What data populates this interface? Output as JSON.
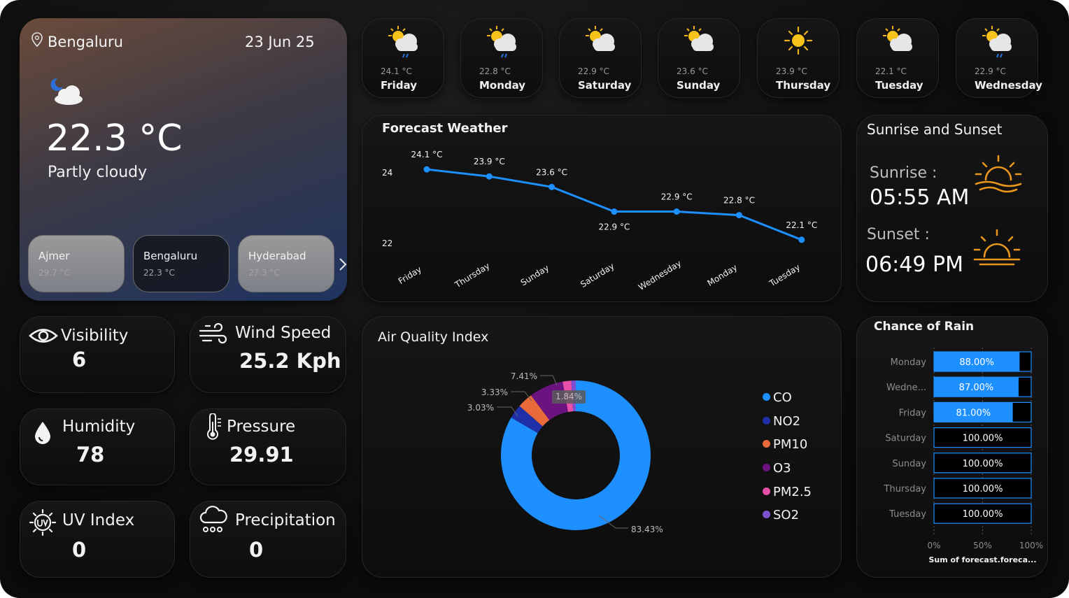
{
  "hero": {
    "city": "Bengaluru",
    "date": "23 Jun 25",
    "temperature": "22.3 °C",
    "condition": "Partly cloudy",
    "cities": [
      {
        "name": "Ajmer",
        "temp": "29.7 °C"
      },
      {
        "name": "Bengaluru",
        "temp": "22.3 °C"
      },
      {
        "name": "Hyderabad",
        "temp": "27.3 °C"
      }
    ],
    "next_icon": "chevron-right-icon"
  },
  "days": [
    {
      "temp": "24.1 °C",
      "day": "Friday",
      "icon": "sun-cloud-rain-icon"
    },
    {
      "temp": "22.8 °C",
      "day": "Monday",
      "icon": "sun-cloud-rain-icon"
    },
    {
      "temp": "22.9 °C",
      "day": "Saturday",
      "icon": "sun-cloud-icon"
    },
    {
      "temp": "23.6 °C",
      "day": "Sunday",
      "icon": "sun-cloud-icon"
    },
    {
      "temp": "23.9 °C",
      "day": "Thursday",
      "icon": "sun-icon"
    },
    {
      "temp": "22.1 °C",
      "day": "Tuesday",
      "icon": "sun-cloud-icon"
    },
    {
      "temp": "22.9 °C",
      "day": "Wednesday",
      "icon": "sun-cloud-rain-icon"
    }
  ],
  "metrics": {
    "visibility": {
      "label": "Visibility",
      "value": "6"
    },
    "wind": {
      "label": "Wind Speed",
      "value": "25.2 Kph"
    },
    "humidity": {
      "label": "Humidity",
      "value": "78"
    },
    "pressure": {
      "label": "Pressure",
      "value": "29.91"
    },
    "uv": {
      "label": "UV Index",
      "value": "0"
    },
    "precipitation": {
      "label": "Precipitation",
      "value": "0"
    }
  },
  "sun": {
    "title": "Sunrise and Sunset",
    "sunrise_label": "Sunrise :",
    "sunrise_time": "05:55 AM",
    "sunset_label": "Sunset :",
    "sunset_time": "06:49 PM"
  },
  "colors": {
    "accent": "#1e8fff",
    "sun": "#f0a030",
    "co": "#1e8fff",
    "no2": "#1f2fa8",
    "pm10": "#e8693a",
    "o3": "#6b137f",
    "pm25": "#e84fa8",
    "so2": "#7e4fd0"
  },
  "chart_data": [
    {
      "type": "line",
      "title": "Forecast Weather",
      "categories": [
        "Friday",
        "Thursday",
        "Sunday",
        "Saturday",
        "Wednesday",
        "Monday",
        "Tuesday"
      ],
      "values": [
        24.1,
        23.9,
        23.6,
        22.9,
        22.9,
        22.8,
        22.1
      ],
      "data_labels": [
        "24.1 °C",
        "23.9 °C",
        "23.6 °C",
        "22.9 °C",
        "22.9 °C",
        "22.8 °C",
        "22.1 °C"
      ],
      "yticks": [
        "24",
        "22"
      ],
      "ylim": [
        21.5,
        24.6
      ],
      "grid": false
    },
    {
      "type": "pie",
      "title": "Air Quality Index",
      "labels": [
        "CO",
        "NO2",
        "PM10",
        "O3",
        "PM2.5",
        "SO2"
      ],
      "values": [
        83.43,
        3.03,
        3.33,
        7.41,
        1.84,
        0.96
      ],
      "data_labels": [
        "83.43%",
        "3.03%",
        "3.33%",
        "7.41%",
        "1.84%",
        ""
      ],
      "legend": "right"
    },
    {
      "type": "bar",
      "title": "Chance of Rain",
      "orientation": "horizontal",
      "categories": [
        "Monday",
        "Wedne...",
        "Friday",
        "Saturday",
        "Sunday",
        "Thursday",
        "Tuesday"
      ],
      "values": [
        88,
        87,
        81,
        100,
        100,
        100,
        100
      ],
      "data_labels": [
        "88.00%",
        "87.00%",
        "81.00%",
        "100.00%",
        "100.00%",
        "100.00%",
        "100.00%"
      ],
      "xticks": [
        "0%",
        "50%",
        "100%"
      ],
      "xlabel": "Sum of forecast.foreca...",
      "xlim": [
        0,
        100
      ]
    }
  ]
}
